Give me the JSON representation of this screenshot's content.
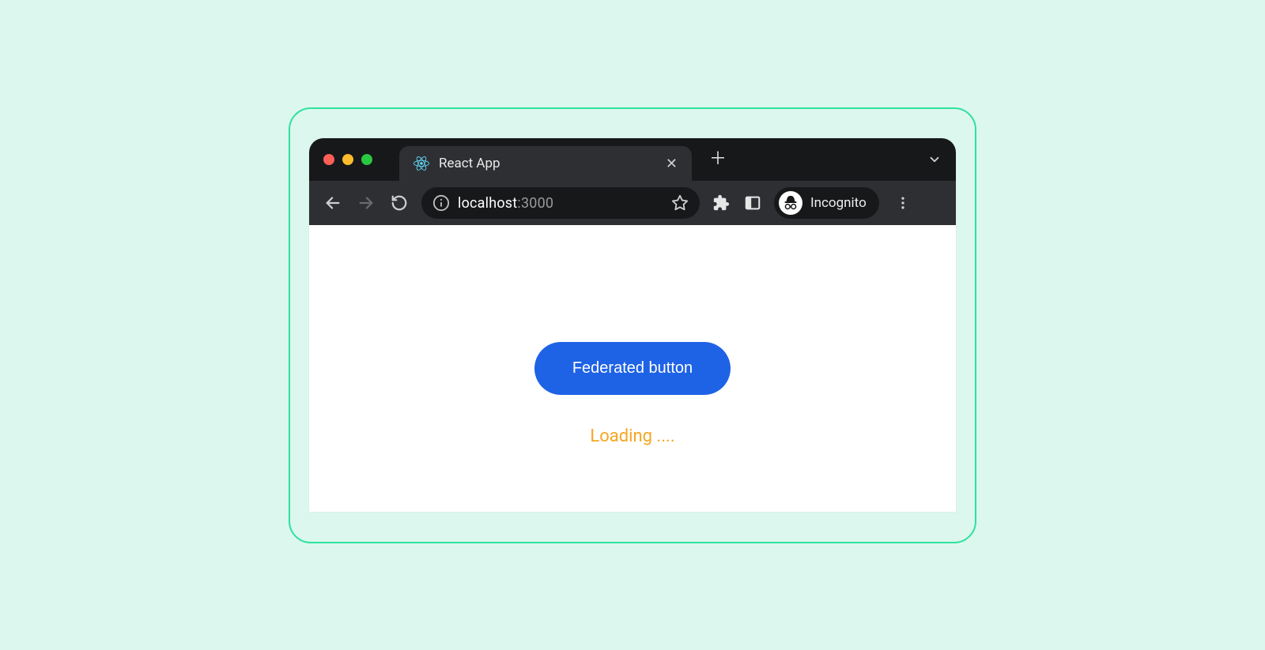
{
  "browser": {
    "tab_title": "React App",
    "url_host": "localhost",
    "url_port": ":3000",
    "incognito_label": "Incognito"
  },
  "page": {
    "button_label": "Federated button",
    "loading_text": "Loading ...."
  }
}
